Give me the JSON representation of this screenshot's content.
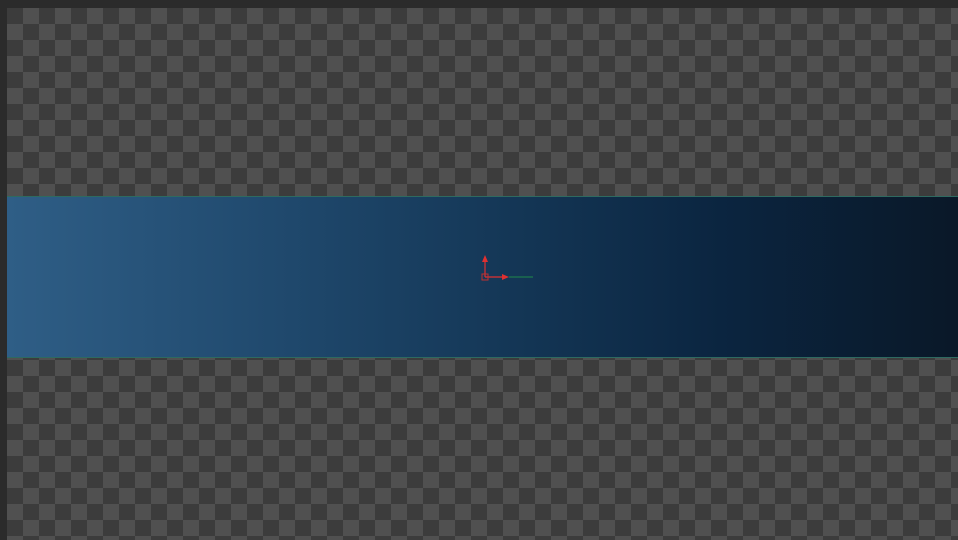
{
  "viewer": {
    "background_pattern": "checkerboard-transparency",
    "band_gradient": [
      "#2f5e86",
      "#0a1828"
    ],
    "band_outline_color": "#2e6a60",
    "transform_widget": {
      "icon": "transform-axes-icon",
      "x_axis_color": "#e03030",
      "y_axis_color": "#e03030",
      "extend_line_color": "#1f8a4a",
      "center_color": "#c03030"
    }
  }
}
